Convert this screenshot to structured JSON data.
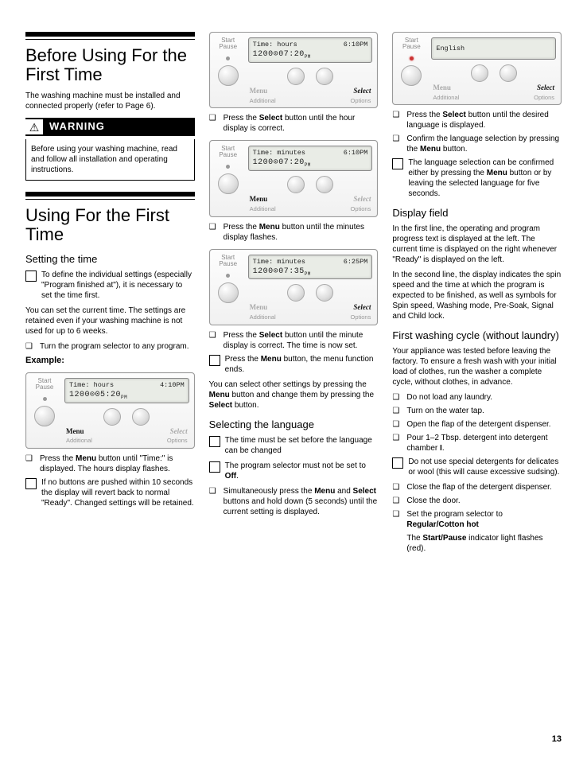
{
  "page_number": "13",
  "col1": {
    "h1a": "Before Using For the First Time",
    "intro": "The washing machine must be installed and connected properly (refer to Page 6).",
    "warn_label": "WARNING",
    "warn_body": "Before using your washing machine, read and follow all installation and operating instructions.",
    "h1b": "Using For the First Time",
    "h2a": "Setting the time",
    "note1": "To define the individual settings (especially \"Program finished at\"), it is necessary to set the time first.",
    "p1": "You can set the current time. The settings are retained even if your washing machine is not used for up  to 6 weeks.",
    "b1": "Turn the program selector to any program.",
    "example_label": "Example:",
    "b2a": "Press the ",
    "b2b": "Menu",
    "b2c": " button until \"Time:\" is displayed. The hours display flashes.",
    "note2": "If no buttons are pushed within 10 seconds the display will revert back to normal \"Ready\". Changed settings will be retained."
  },
  "col2": {
    "b1a": "Press the ",
    "b1b": "Select",
    "b1c": " button until the hour display is correct.",
    "b2a": "Press the ",
    "b2b": "Menu",
    "b2c": " button until the minutes display flashes.",
    "b3a": "Press the ",
    "b3b": "Select",
    "b3c": " button until the minute display is correct. The time is now set.",
    "note1a": "Press the ",
    "note1b": "Menu",
    "note1c": " button, the menu function ends.",
    "p1a": "You can select other settings by pressing the ",
    "p1b": "Menu",
    "p1c": " button and change them by pressing the ",
    "p1d": "Select",
    "p1e": " button.",
    "h2a": "Selecting the language",
    "note2": "The time must be set before the language can be changed",
    "note3a": "The program selector must not be set to ",
    "note3b": "Off",
    "note3c": ".",
    "b4a": "Simultaneously press the ",
    "b4b": "Menu",
    "b4c": " and ",
    "b4d": "Select",
    "b4e": " buttons and hold down (5 seconds) until the current setting is displayed."
  },
  "col3": {
    "b1a": "Press the ",
    "b1b": "Select",
    "b1c": " button until the desired language is displayed.",
    "b2a": "Confirm the language selection by pressing the ",
    "b2b": "Menu",
    "b2c": " button.",
    "note1a": "The language selection can be confirmed either by pressing the ",
    "note1b": "Menu",
    "note1c": " button or by leaving the selected language for five seconds.",
    "h2a": "Display field",
    "p1": "In the first line, the operating and program progress text is displayed at the left. The current time is displayed on the right whenever \"Ready\" is displayed on the left.",
    "p2": "In the second line, the display indicates the spin speed and the time at which the program is expected to be finished, as well as symbols for Spin speed, Washing mode, Pre-Soak, Signal and Child lock.",
    "h2b": "First washing cycle (without laundry)",
    "p3": "Your appliance was tested before leaving the factory.  To ensure a fresh wash with your initial load of clothes, run the washer a complete cycle, without clothes, in advance.",
    "b3": "Do not load any laundry.",
    "b4": "Turn on the water tap.",
    "b5": "Open the flap of the detergent dispenser.",
    "b6a": "Pour 1–2 Tbsp. detergent into detergent chamber ",
    "b6b": "I",
    "b6c": ".",
    "note2": "Do not use special detergents for delicates or wool (this will cause excessive sudsing).",
    "b7": "Close the flap of the detergent dispenser.",
    "b8": "Close the door.",
    "b9a": "Set the program selector to ",
    "b9b": "Regular/Cotton hot",
    "b10a": "The ",
    "b10b": "Start/Pause",
    "b10c": " indicator light flashes (red)."
  },
  "panels": {
    "sp": "Start\nPause",
    "menu": "Menu",
    "select": "Select",
    "add": "Additional",
    "opt": "Options",
    "p1": {
      "l1a": "Time: hours",
      "l1b": "4:10PM",
      "l2": "1200⊙05:20",
      "l2s": "PM"
    },
    "p2": {
      "l1a": "Time: hours",
      "l1b": "6:10PM",
      "l2": "1200⊙07:20",
      "l2s": "PM"
    },
    "p3": {
      "l1a": "Time: minutes",
      "l1b": "6:10PM",
      "l2": "1200⊙07:20",
      "l2s": "PM"
    },
    "p4": {
      "l1a": "Time: minutes",
      "l1b": "6:25PM",
      "l2": "1200⊙07:35",
      "l2s": "PM"
    },
    "p5": {
      "l1": "English"
    }
  }
}
